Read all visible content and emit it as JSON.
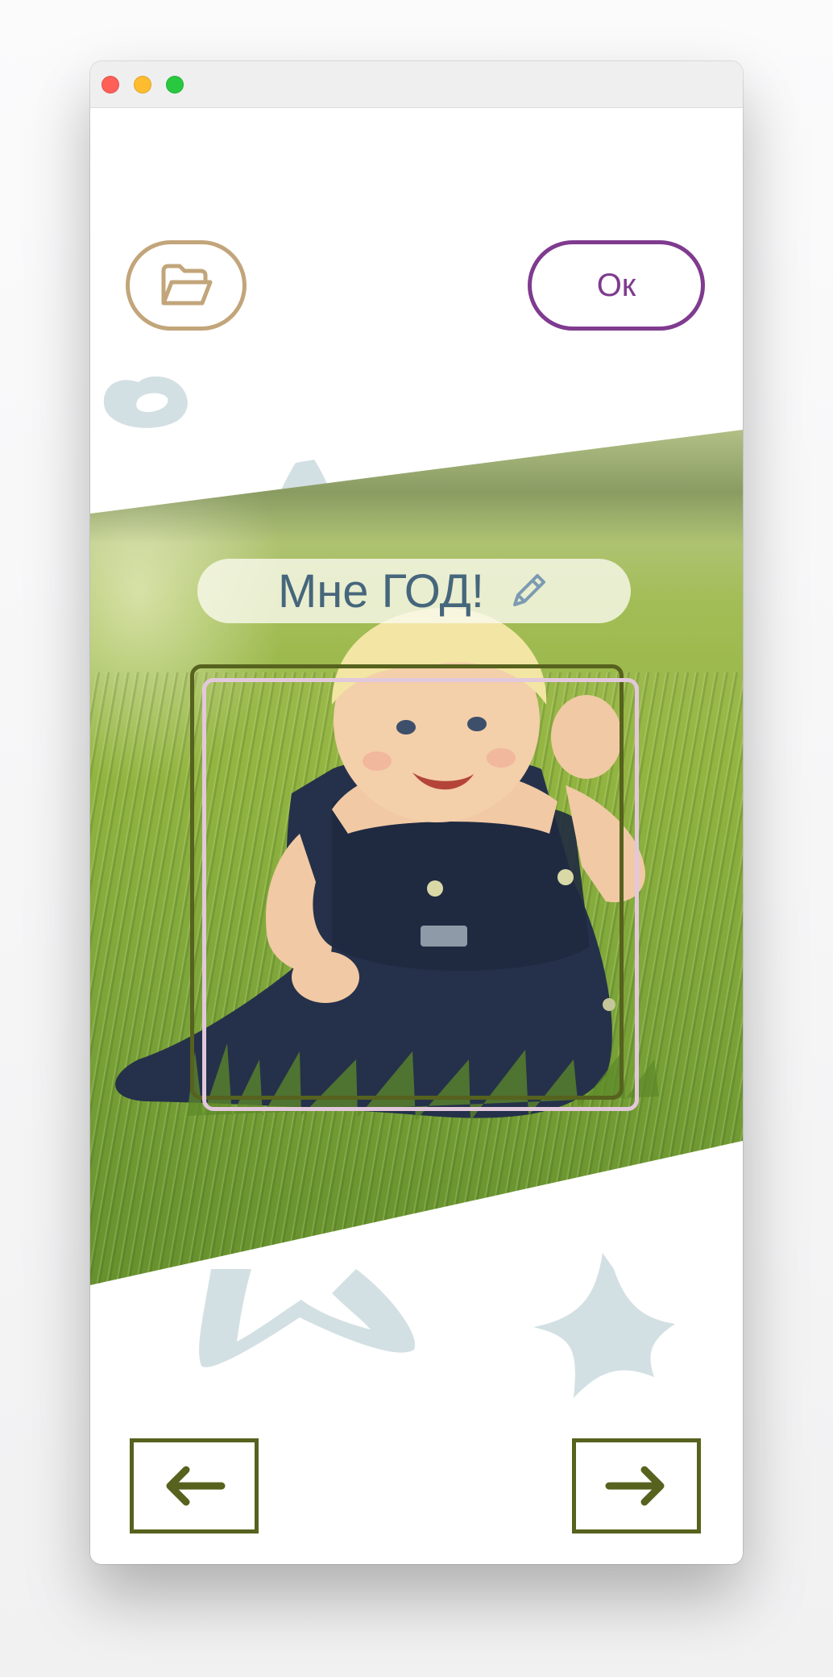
{
  "window": {
    "controls": [
      "close",
      "minimize",
      "maximize"
    ]
  },
  "toolbar": {
    "open_icon": "folder-open-icon",
    "ok_label": "Ок"
  },
  "photo": {
    "caption": "Мне ГОД!",
    "edit_icon": "pencil-icon"
  },
  "navigation": {
    "prev_icon": "arrow-left-icon",
    "next_icon": "arrow-right-icon"
  },
  "colors": {
    "folder_accent": "#c2a57a",
    "ok_accent": "#7f3b8f",
    "nav_accent": "#56621e",
    "caption_text": "#46667c",
    "decor": "#d3e0e3",
    "crop_outer": "#56621e",
    "crop_inner": "#e2c8dd"
  }
}
